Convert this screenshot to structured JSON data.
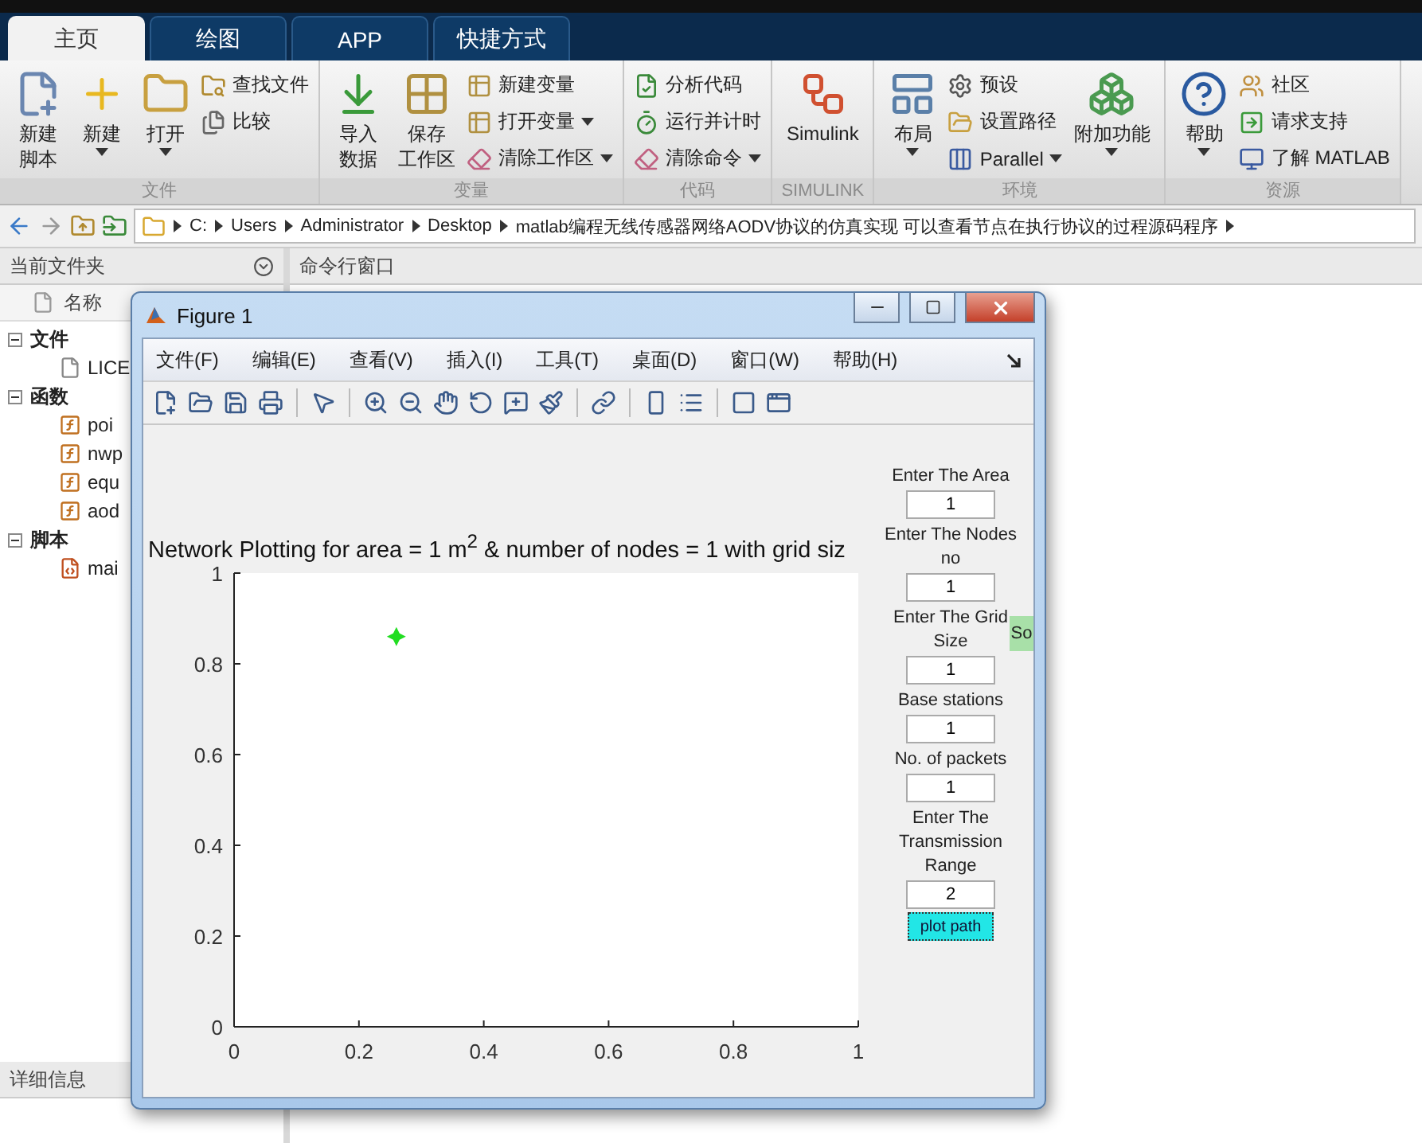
{
  "tabs": [
    {
      "label": "主页",
      "selected": true
    },
    {
      "label": "绘图",
      "selected": false
    },
    {
      "label": "APP",
      "selected": false
    },
    {
      "label": "快捷方式",
      "selected": false
    }
  ],
  "ribbon": [
    {
      "label": "文件",
      "items": [
        {
          "kind": "large",
          "lines": [
            "新建",
            "脚本"
          ],
          "dropdown": false
        },
        {
          "kind": "large",
          "lines": [
            "新建"
          ],
          "dropdown": true
        },
        {
          "kind": "large",
          "lines": [
            "打开"
          ],
          "dropdown": true
        },
        {
          "kind": "stack",
          "items": [
            {
              "label": "查找文件",
              "dropdown": false
            },
            {
              "label": "比较",
              "dropdown": false
            }
          ]
        }
      ]
    },
    {
      "label": "变量",
      "items": [
        {
          "kind": "large",
          "lines": [
            "导入",
            "数据"
          ],
          "dropdown": false
        },
        {
          "kind": "large",
          "lines": [
            "保存",
            "工作区"
          ],
          "dropdown": false
        },
        {
          "kind": "stack",
          "items": [
            {
              "label": "新建变量",
              "dropdown": false
            },
            {
              "label": "打开变量",
              "dropdown": true
            },
            {
              "label": "清除工作区",
              "dropdown": true
            }
          ]
        }
      ]
    },
    {
      "label": "代码",
      "items": [
        {
          "kind": "stack",
          "items": [
            {
              "label": "分析代码",
              "dropdown": false
            },
            {
              "label": "运行并计时",
              "dropdown": false
            },
            {
              "label": "清除命令",
              "dropdown": true
            }
          ]
        }
      ]
    },
    {
      "label": "SIMULINK",
      "items": [
        {
          "kind": "large",
          "lines": [
            "Simulink"
          ],
          "dropdown": false
        }
      ]
    },
    {
      "label": "环境",
      "items": [
        {
          "kind": "large",
          "lines": [
            "布局"
          ],
          "dropdown": true
        },
        {
          "kind": "stack",
          "items": [
            {
              "label": "预设",
              "dropdown": false
            },
            {
              "label": "设置路径",
              "dropdown": false
            },
            {
              "label": "Parallel",
              "dropdown": true
            }
          ]
        },
        {
          "kind": "large",
          "lines": [
            "附加功能"
          ],
          "dropdown": true
        }
      ]
    },
    {
      "label": "资源",
      "items": [
        {
          "kind": "large",
          "lines": [
            "帮助"
          ],
          "dropdown": true
        },
        {
          "kind": "stack",
          "items": [
            {
              "label": "社区",
              "dropdown": false
            },
            {
              "label": "请求支持",
              "dropdown": false
            },
            {
              "label": "了解 MATLAB",
              "dropdown": false
            }
          ]
        }
      ]
    }
  ],
  "address": {
    "segments": [
      "C:",
      "Users",
      "Administrator",
      "Desktop",
      "matlab编程无线传感器网络AODV协议的仿真实现 可以查看节点在执行协议的过程源码程序"
    ]
  },
  "current_folder": {
    "title": "当前文件夹",
    "column": "名称",
    "groups": [
      {
        "label": "文件",
        "expanded": true,
        "children": [
          {
            "kind": "file",
            "label": "LICE"
          }
        ]
      },
      {
        "label": "函数",
        "expanded": true,
        "children": [
          {
            "kind": "function",
            "label": "poi"
          },
          {
            "kind": "function",
            "label": "nwp"
          },
          {
            "kind": "function",
            "label": "equ"
          },
          {
            "kind": "function",
            "label": "aod"
          }
        ]
      },
      {
        "label": "脚本",
        "expanded": true,
        "children": [
          {
            "kind": "script",
            "label": "mai"
          }
        ]
      }
    ]
  },
  "details": {
    "title": "详细信息"
  },
  "command_window": {
    "title": "命令行窗口"
  },
  "figure": {
    "title": "Figure 1",
    "menu": [
      "文件(F)",
      "编辑(E)",
      "查看(V)",
      "插入(I)",
      "工具(T)",
      "桌面(D)",
      "窗口(W)",
      "帮助(H)"
    ],
    "controls": [
      {
        "kind": "label",
        "text": "Enter The Area"
      },
      {
        "kind": "input",
        "value": "1"
      },
      {
        "kind": "label",
        "text": "Enter The Nodes no"
      },
      {
        "kind": "input",
        "value": "1"
      },
      {
        "kind": "label",
        "text": "Enter The Grid Size"
      },
      {
        "kind": "input",
        "value": "1"
      },
      {
        "kind": "label",
        "text": "Base stations"
      },
      {
        "kind": "input",
        "value": "1"
      },
      {
        "kind": "label",
        "text": "No. of packets"
      },
      {
        "kind": "input",
        "value": "1"
      },
      {
        "kind": "label",
        "text": "Enter The Transmission Range"
      },
      {
        "kind": "input",
        "value": "2"
      }
    ],
    "button": {
      "label": "plot path"
    },
    "side_button": {
      "label": "So"
    },
    "chart_data": {
      "type": "scatter",
      "title": "Network Plotting for area = 1 m$^{2}$ & number of nodes = 1 with grid siz",
      "x": [
        0.26
      ],
      "series": [
        {
          "color": "#22dd22",
          "values": [
            0.86
          ]
        }
      ],
      "xlim": [
        0,
        1
      ],
      "ylim": [
        0,
        1
      ],
      "xticks": [
        0,
        0.2,
        0.4,
        0.6,
        0.8,
        1
      ],
      "yticks": [
        0,
        0.2,
        0.4,
        0.6,
        0.8,
        1
      ]
    }
  }
}
